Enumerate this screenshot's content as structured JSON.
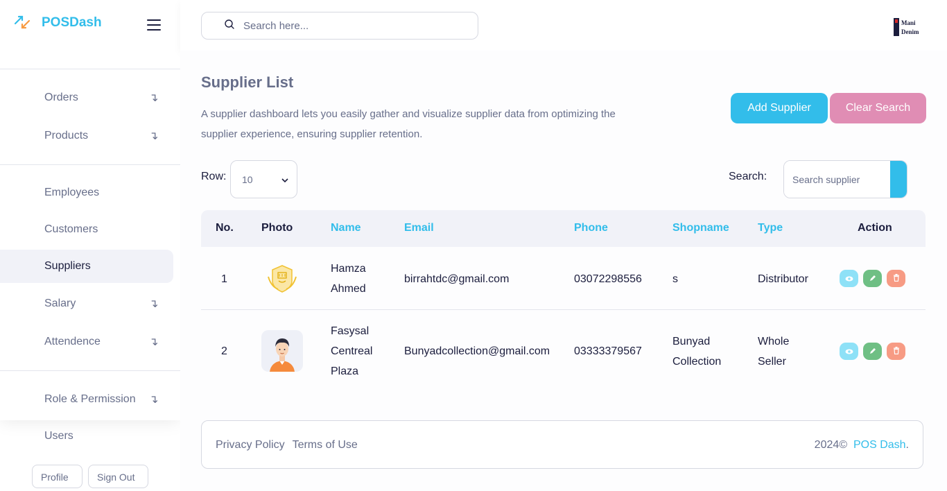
{
  "brand": {
    "name": "POSDash"
  },
  "header": {
    "search_placeholder": "Search here...",
    "avatar_logo_line1": "Mani",
    "avatar_logo_line2": "Denim"
  },
  "sidebar": {
    "items": [
      {
        "label": "Orders",
        "has_submenu": true
      },
      {
        "label": "Products",
        "has_submenu": true
      },
      {
        "label": "Employees",
        "has_submenu": false
      },
      {
        "label": "Customers",
        "has_submenu": false
      },
      {
        "label": "Suppliers",
        "has_submenu": false,
        "active": true
      },
      {
        "label": "Salary",
        "has_submenu": true
      },
      {
        "label": "Attendence",
        "has_submenu": true
      },
      {
        "label": "Role & Permission",
        "has_submenu": true
      },
      {
        "label": "Users",
        "has_submenu": false
      }
    ],
    "submenu_arrow": "↴",
    "profile_label": "Profile",
    "signout_label": "Sign Out"
  },
  "main": {
    "title": "Supplier List",
    "description": "A supplier dashboard lets you easily gather and visualize supplier data from optimizing the supplier experience, ensuring supplier retention.",
    "add_button": "Add Supplier",
    "clear_button": "Clear Search",
    "row_label": "Row:",
    "row_value": "10",
    "search_label": "Search:",
    "search_placeholder": "Search supplier"
  },
  "table": {
    "headers": [
      "No.",
      "Photo",
      "Name",
      "Email",
      "Phone",
      "Shopname",
      "Type",
      "Action"
    ],
    "rows": [
      {
        "no": "1",
        "photo": "logo-badge",
        "name_lines": [
          "Hamza",
          "Ahmed"
        ],
        "email": "birrahtdc@gmail.com",
        "phone": "03072298556",
        "shop_lines": [
          "s"
        ],
        "type_lines": [
          "Distributor"
        ]
      },
      {
        "no": "2",
        "photo": "person-avatar",
        "name_lines": [
          "Fasysal",
          "Centreal",
          "Plaza"
        ],
        "email": "Bunyadcollection@gmail.com",
        "phone": "03333379567",
        "shop_lines": [
          "Bunyad",
          "Collection"
        ],
        "type_lines": [
          "Whole",
          "Seller"
        ]
      }
    ]
  },
  "footer": {
    "privacy": "Privacy Policy",
    "terms": "Terms of Use",
    "copyright_prefix": "2024©",
    "brand": "POS Dash",
    "suffix": "."
  },
  "colors": {
    "accent": "#32bdea",
    "pink": "#e08db4",
    "text": "#676e8a",
    "dark": "#1b1d3d"
  }
}
